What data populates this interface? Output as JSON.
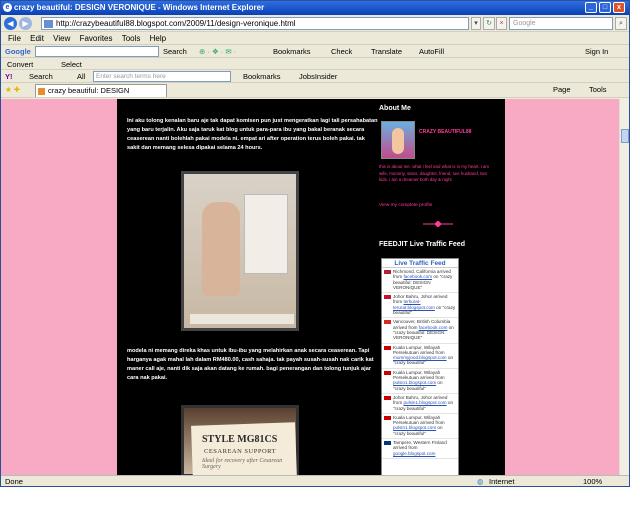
{
  "window": {
    "title": "crazy beautiful: DESIGN VERONIQUE - Windows Internet Explorer"
  },
  "address": {
    "url": "http://crazybeautiful88.blogspot.com/2009/11/design-veronique.html",
    "search_placeholder": "Google"
  },
  "menu": [
    "File",
    "Edit",
    "View",
    "Favorites",
    "Tools",
    "Help"
  ],
  "google_toolbar": {
    "label": "Google",
    "search": "Search",
    "bookmarks": "Bookmarks",
    "check": "Check",
    "translate": "Translate",
    "autofill": "AutoFill",
    "signin": "Sign In"
  },
  "convert_bar": {
    "convert": "Convert",
    "select": "Select"
  },
  "yahoo_bar": {
    "search": "Search",
    "all": "All",
    "placeholder": "Enter search terms here",
    "bookmarks": "Bookmarks",
    "jobsinsider": "JobsInsider"
  },
  "tab": {
    "label": "crazy beautiful: DESIGN VERONIQUE",
    "page": "Page",
    "tools": "Tools"
  },
  "post": {
    "para1": "Ini aku tolong kenalan baru aje tak dapat komisen pun just mengeratkan lagi tali persahabatan yang baru terjalin. Aku saja taruk kat blog untuk para-para ibu yang bakal beranak secara ceaserean nanti bolehlah pakai modela ni. empat ari after operation terus boleh pakai. tak sakit dan memang selesa dipakai selama 24 hours.",
    "para2": "modela ni memang direka khas untuk ibu-ibu yang melahirkan anak secara ceaserean. Tapi harganya agak mahal lah dalam RM480.00, cash sahaja. tak payah susah-susah nak carik kat maner call aje, nanti dik saja akan datang ke rumah. bagi penerangan dan tolong tunjuk ajar cara nak pakai.",
    "img2_line1": "STYLE MG81CS",
    "img2_line2": "CESAREAN SUPPORT",
    "img2_line3": "Ideal for recovery after Cesarean Surgery"
  },
  "sidebar": {
    "about_title": "About Me",
    "about_name": "CRAZY BEAUTIFUL88",
    "about_desc": "this is about me. what i feel and what is in my heart. i am wife, mommy, sister, daughter, friend, see husband, two kids. i am a dreamer both day & night",
    "profile_link": "View my complete profile",
    "feed_title": "FEEDJIT Live Traffic Feed",
    "feed_head": "Live Traffic Feed",
    "feed": [
      {
        "loc": "Richmond, California arrived from",
        "src": "facebook.com",
        "rest": "on \"crazy beautiful: DESIGN VERONIQUE\""
      },
      {
        "loc": "Johor Bahru, Johor arrived from",
        "src": "terkurat-terurat.blogspot.com",
        "rest": "on \"crazy beautiful\""
      },
      {
        "loc": "Vancouver, British Columbia arrived from",
        "src": "facebook.com",
        "rest": "on \"crazy beautiful: DESIGN VERONIQUE\""
      },
      {
        "loc": "Kuala Lumpur, Wilayah Persekutuan arrived from",
        "src": "mummyjood.blogspot.com",
        "rest": "on \"crazy beautiful\""
      },
      {
        "loc": "Kuala Lumpur, Wilayah Persekutuan arrived from",
        "src": "pulsin1.blogspot.com",
        "rest": "on \"crazy beautiful\""
      },
      {
        "loc": "Johor Bahru, Johor arrived from",
        "src": "pulsin1.blogspot.com",
        "rest": "on \"crazy beautiful\""
      },
      {
        "loc": "Kuala Lumpur, Wilayah Persekutuan arrived from",
        "src": "pulsin1.blogspot.com",
        "rest": "on \"crazy beautiful\""
      },
      {
        "loc": "Tampere, Western Finland arrived from",
        "src": "google.blogspot.com",
        "rest": ""
      }
    ]
  },
  "status": {
    "left": "Done",
    "zone": "Internet",
    "zoom": "100%"
  }
}
